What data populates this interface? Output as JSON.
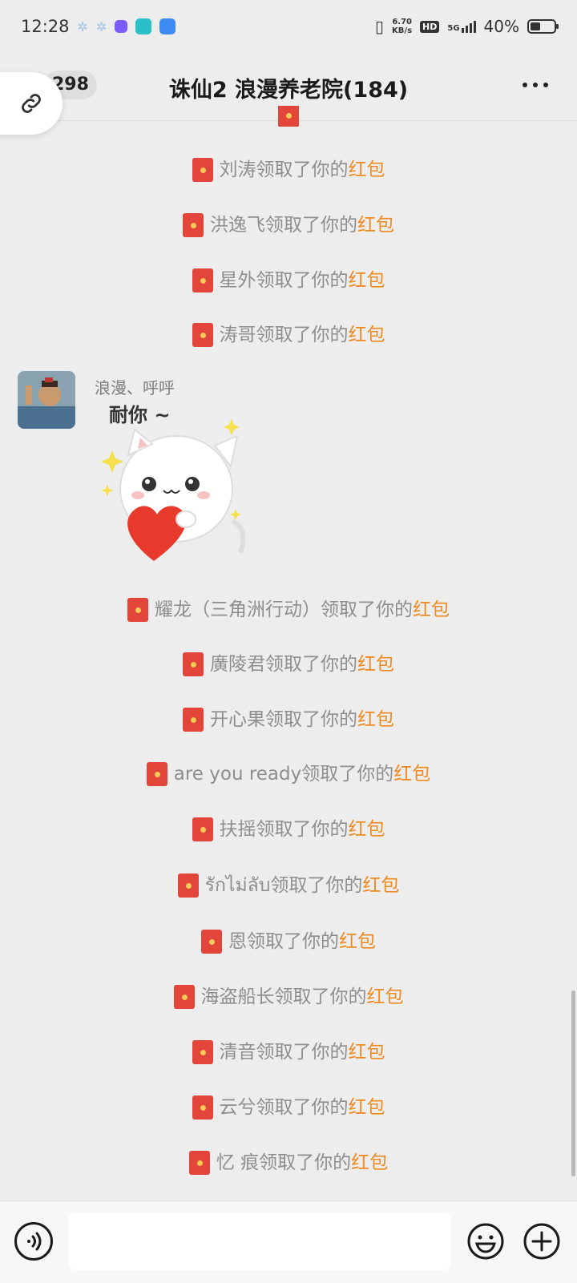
{
  "status_bar": {
    "time": "12:28",
    "net_speed_value": "6.70",
    "net_speed_unit": "KB/s",
    "hd": "HD",
    "network": "5G",
    "battery": "40%"
  },
  "header": {
    "unread_count": "298",
    "title": "诛仙2  浪漫养老院(184)"
  },
  "claim_suffix": "领取了你的",
  "red_packet": "红包",
  "messages_top": [
    {
      "name": "刘涛"
    },
    {
      "name": "洪逸飞"
    },
    {
      "name": "星外"
    },
    {
      "name": "涛哥"
    }
  ],
  "sticker_message": {
    "sender": "浪漫、呼呼",
    "sticker_text": "耐你 ~"
  },
  "messages_bottom": [
    {
      "name": "耀龙（三角洲行动）"
    },
    {
      "name": "廣陵君"
    },
    {
      "name": "开心果"
    },
    {
      "name": "are you ready"
    },
    {
      "name": "扶摇"
    },
    {
      "name": "รักไม่ลับ"
    },
    {
      "name": "恩"
    },
    {
      "name": "海盗船长"
    },
    {
      "name": "清音"
    },
    {
      "name": "云兮"
    },
    {
      "name": "忆 痕"
    }
  ],
  "colors": {
    "red_packet_text": "#f08a1f",
    "red_packet_icon": "#e2463b",
    "background": "#ededed"
  }
}
